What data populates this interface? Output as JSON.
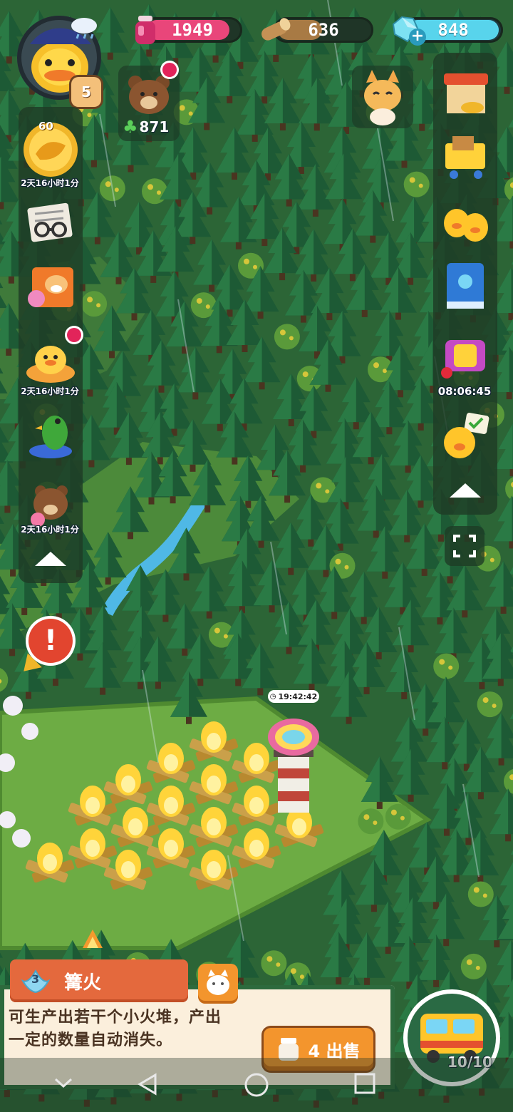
{
  "resources": {
    "potion": "1949",
    "wood": "636",
    "gems": "848"
  },
  "player": {
    "level": "5"
  },
  "friend": {
    "clover_count": "871"
  },
  "left_panel": {
    "items": [
      {
        "icon": "golden-bird-icon",
        "badge": "60",
        "timer": "2天16小时1分"
      },
      {
        "icon": "newspaper-icon"
      },
      {
        "icon": "shiba-box-icon"
      },
      {
        "icon": "duck-cake-icon",
        "timer": "2天16小时1分"
      },
      {
        "icon": "peacock-icon"
      },
      {
        "icon": "bear-lollipop-icon",
        "timer": "2天16小时1分"
      }
    ]
  },
  "right_panel": {
    "items": [
      {
        "icon": "shop-stall-icon"
      },
      {
        "icon": "cart-icon"
      },
      {
        "icon": "twin-ducks-icon"
      },
      {
        "icon": "blue-book-icon"
      },
      {
        "icon": "gift-chest-icon",
        "timer": "08:06:45"
      },
      {
        "icon": "duck-checklist-icon"
      }
    ]
  },
  "lighthouse": {
    "timer": "19:42:42"
  },
  "selected": {
    "level": "3",
    "name": "篝火",
    "description": "可生产出若干个小火堆，产出一定的数量自动消失。",
    "sell_label": "4 出售"
  },
  "vehicle": {
    "capacity": "10/10"
  },
  "colors": {
    "potion_bar": "#e9467a",
    "wood_bar": "#a87a44",
    "gem_bar": "#58d4ec",
    "forest": "#2f6a38",
    "card_bg": "#fbefdc",
    "tag": "#e4693d",
    "sell": "#f3952d"
  }
}
